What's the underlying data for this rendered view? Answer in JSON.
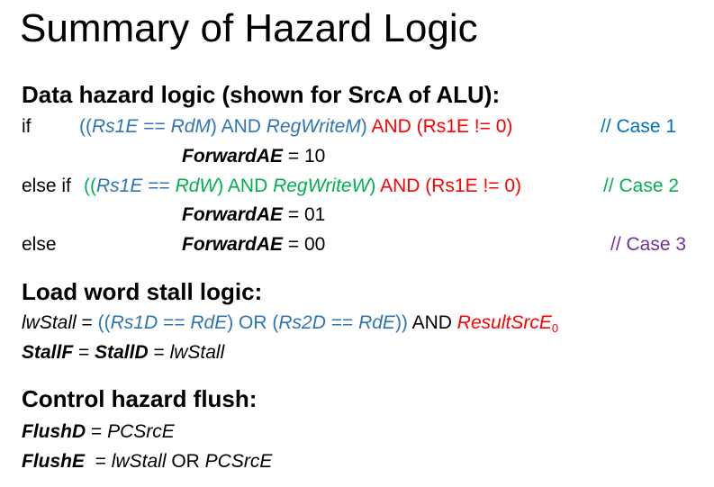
{
  "title": "Summary of Hazard Logic",
  "data_hazard": {
    "heading": "Data hazard logic (shown for SrcA of ALU):",
    "if_kw": "if",
    "else_if_kw": "else if",
    "else_kw": "else",
    "case1": {
      "open": "((",
      "rs1e": "Rs1E",
      "eq": " == ",
      "reg": "RdM",
      "close1": ") AND ",
      "regwrite": "RegWriteM",
      "close2": ")",
      "and_red": " AND (Rs1E != 0)",
      "comment": "// Case 1",
      "assign_var": "ForwardAE",
      "assign_val": " = 10"
    },
    "case2": {
      "open": "((",
      "rs1e": "Rs1E",
      "eq": " == ",
      "reg": "RdW",
      "close1": ") AND ",
      "regwrite": "RegWriteW",
      "close2": ")",
      "and_red": " AND (Rs1E != 0)",
      "comment": "// Case 2",
      "assign_var": "ForwardAE",
      "assign_val": " = 01"
    },
    "case3": {
      "assign_var": "ForwardAE",
      "assign_val": " = 00",
      "comment": "// Case 3"
    }
  },
  "load_stall": {
    "heading": "Load word stall logic:",
    "lwstall": "lwStall",
    "eq": " = ",
    "open": "((",
    "rs1d": "Rs1D",
    "eqeq": " == ",
    "rde": "RdE",
    "or_mid": ") OR (",
    "rs2d": "Rs2D",
    "close": "))",
    "and": " AND ",
    "resultsrc": "ResultSrcE",
    "sub": "0",
    "stallf": "StallF",
    "stalld": "StallD",
    "eq2": " = ",
    "eq3": " = ",
    "lwstall2": "lwStall"
  },
  "control": {
    "heading": "Control hazard flush:",
    "flushd": "FlushD",
    "eq": " = ",
    "pcsrce": "PCSrcE",
    "flushe": "FlushE",
    "eq2": "  = ",
    "lwstall": "lwStall",
    "or": " OR ",
    "pcsrce2": "PCSrcE"
  }
}
